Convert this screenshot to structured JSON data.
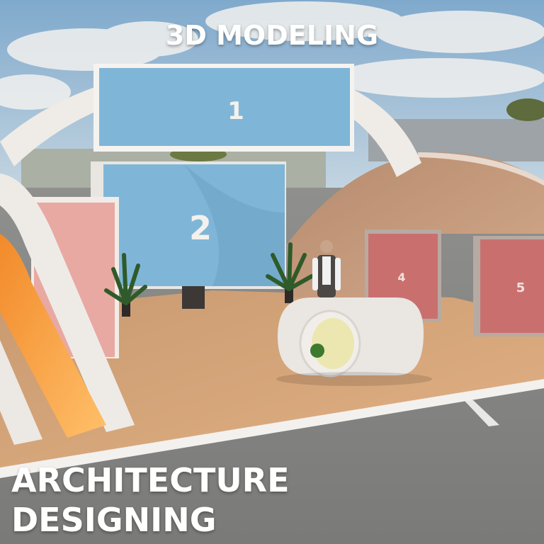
{
  "headline_top": "3D MODELING",
  "headline_bottom_1": "ARCHITECTURE",
  "headline_bottom_2": "DESIGNING",
  "panels": [
    {
      "label": "1"
    },
    {
      "label": "2"
    },
    {
      "label": "4"
    },
    {
      "label": "5"
    }
  ],
  "colors": {
    "sky": "#8fb6d6",
    "ground": "#8c8b88",
    "floor": "#d8a476",
    "panel_blue": "#7fb6d8",
    "panel_pink": "#e8a9a2",
    "panel_red": "#c9706f",
    "arch": "#eeeae6",
    "dome": "#c69a7c",
    "orange": "#f79a3a"
  }
}
